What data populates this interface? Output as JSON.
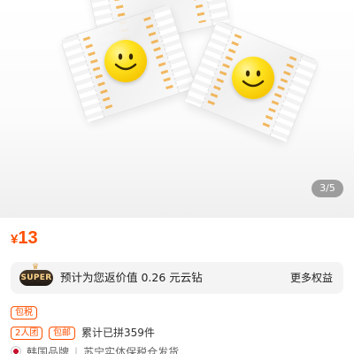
{
  "gallery": {
    "page_indicator": "3/5",
    "candy_color": "#ffd91a"
  },
  "product": {
    "currency": "¥",
    "price": "13"
  },
  "rebate": {
    "badge": "SUPER",
    "text": "预计为您返价值 0.26 元云钻",
    "more_label": "更多权益"
  },
  "tags": {
    "free_shipping": "包税",
    "group": "2人团",
    "free_post": "包邮"
  },
  "sales": {
    "sold_text": "累计已拼359件"
  },
  "footer": {
    "brand_text": "韩国品牌",
    "guarantee_text": "苏宁实体保税仓发货"
  },
  "colors": {
    "accent": "#ff5000",
    "panel": "#f4f4f4"
  }
}
